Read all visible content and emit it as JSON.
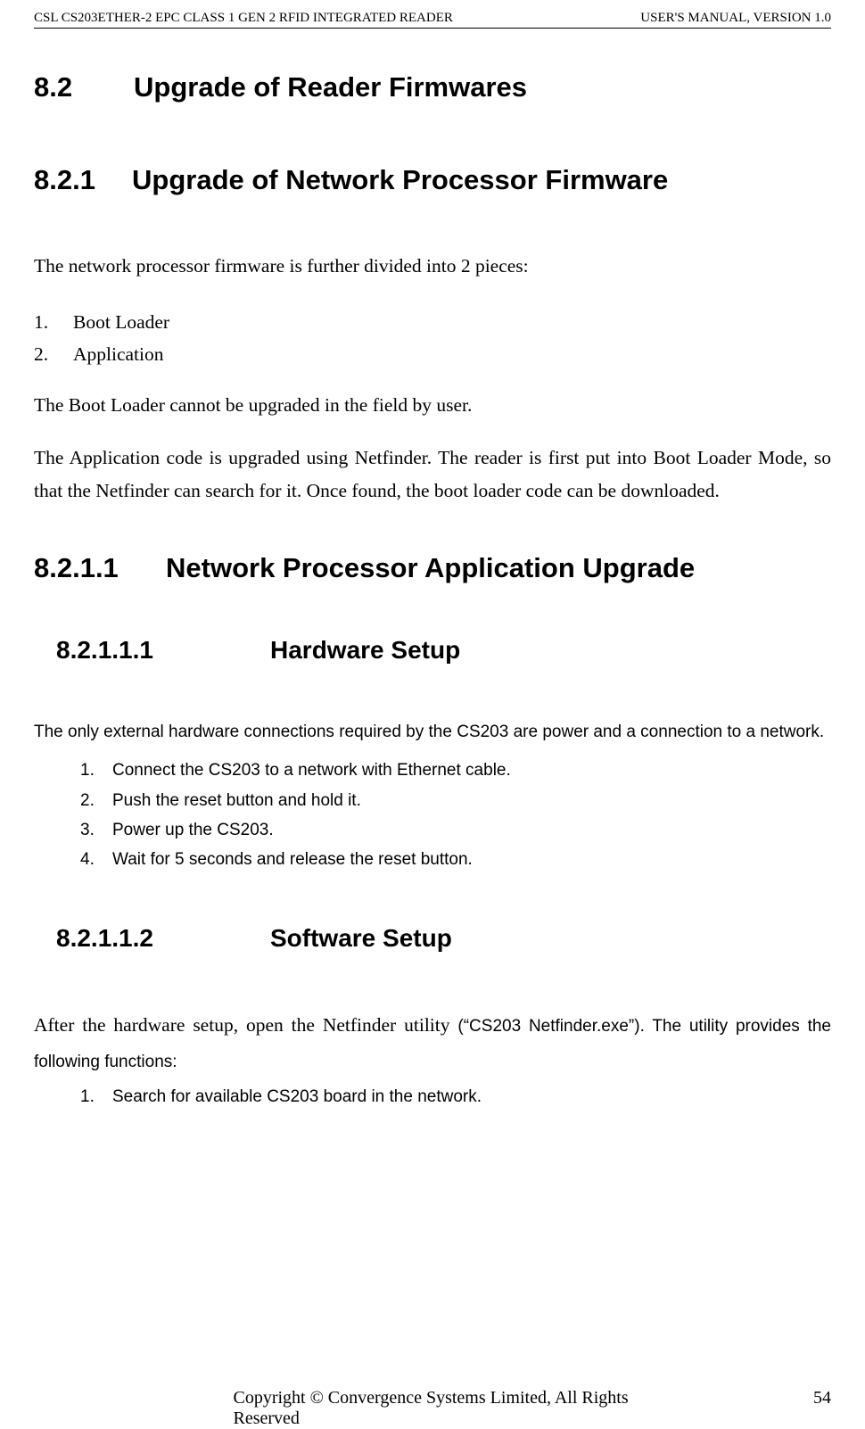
{
  "header": {
    "left": "CSL CS203ETHER-2 EPC CLASS 1 GEN 2 RFID INTEGRATED READER",
    "right": "USER'S  MANUAL,  VERSION  1.0"
  },
  "sections": {
    "s82": {
      "number": "8.2",
      "title": "Upgrade of Reader Firmwares"
    },
    "s821": {
      "number": "8.2.1",
      "title": "Upgrade of Network Processor Firmware"
    },
    "s8211": {
      "number": "8.2.1.1",
      "title": "Network Processor Application Upgrade"
    },
    "s82111": {
      "number": "8.2.1.1.1",
      "title": "Hardware Setup"
    },
    "s82112": {
      "number": "8.2.1.1.2",
      "title": "Software Setup"
    }
  },
  "body": {
    "p1": "The network processor firmware is further divided into 2 pieces:",
    "list1": {
      "n1": "1.",
      "i1": "Boot Loader",
      "n2": "2.",
      "i2": "Application"
    },
    "p2": "The Boot Loader cannot be upgraded in the field by user.",
    "p3": "The Application code is upgraded using Netfinder.   The reader is first put into Boot Loader Mode, so that the Netfinder can search for it.  Once found, the boot loader code can be downloaded.",
    "p4": "The only external hardware connections required by the CS203 are power and a connection to a network.",
    "hwlist": {
      "n1": "1.",
      "i1": "Connect the CS203 to a network with Ethernet cable.",
      "n2": "2.",
      "i2": "Push the reset button and hold it.",
      "n3": "3.",
      "i3": "Power up the CS203.",
      "n4": "4.",
      "i4": "Wait for 5 seconds and release the reset button."
    },
    "p5_serif": "After the hardware setup, open the Netfinder utility ",
    "p5_arial": "(“CS203 Netfinder.exe”). The utility provides the following functions:",
    "swlist": {
      "n1": "1.",
      "i1": "Search for available CS203 board in the network."
    }
  },
  "footer": {
    "center": "Copyright © Convergence Systems Limited, All Rights Reserved",
    "right": "54"
  }
}
